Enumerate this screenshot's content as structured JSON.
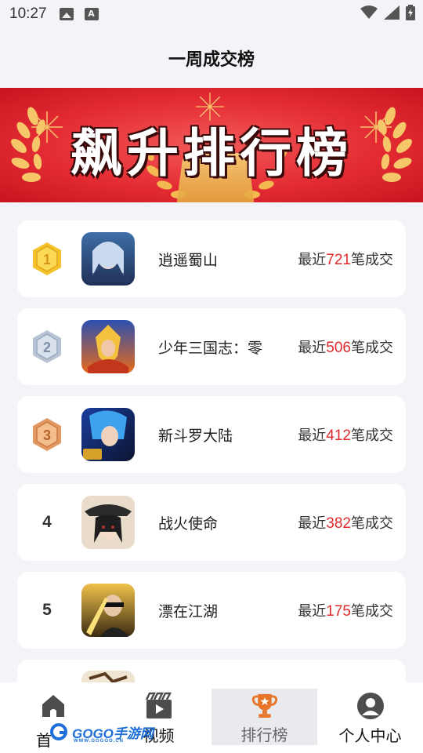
{
  "status_bar": {
    "time": "10:27"
  },
  "header": {
    "title": "一周成交榜"
  },
  "banner": {
    "title": "飙升排行榜"
  },
  "ranking": [
    {
      "rank": "1",
      "name": "逍遥蜀山",
      "deals_prefix": "最近",
      "deals_count": "721",
      "deals_suffix": "笔成交",
      "medal": "gold"
    },
    {
      "rank": "2",
      "name": "少年三国志：零",
      "deals_prefix": "最近",
      "deals_count": "506",
      "deals_suffix": "笔成交",
      "medal": "silver"
    },
    {
      "rank": "3",
      "name": "新斗罗大陆",
      "deals_prefix": "最近",
      "deals_count": "412",
      "deals_suffix": "笔成交",
      "medal": "bronze"
    },
    {
      "rank": "4",
      "name": "战火使命",
      "deals_prefix": "最近",
      "deals_count": "382",
      "deals_suffix": "笔成交"
    },
    {
      "rank": "5",
      "name": "漂在江湖",
      "deals_prefix": "最近",
      "deals_count": "175",
      "deals_suffix": "笔成交"
    }
  ],
  "tabbar": {
    "home": "首",
    "video": "视频",
    "ranking": "排行榜",
    "profile": "个人中心"
  },
  "watermark": {
    "text": "GOGO手游网",
    "subtext": "WWW.GOGOO.CN"
  },
  "colors": {
    "accent": "#e8762a",
    "deal_count": "#e02b2b",
    "banner_red": "#e42c34",
    "gold": "#f5c22a",
    "silver": "#b7c3d3",
    "bronze": "#e29a62"
  }
}
